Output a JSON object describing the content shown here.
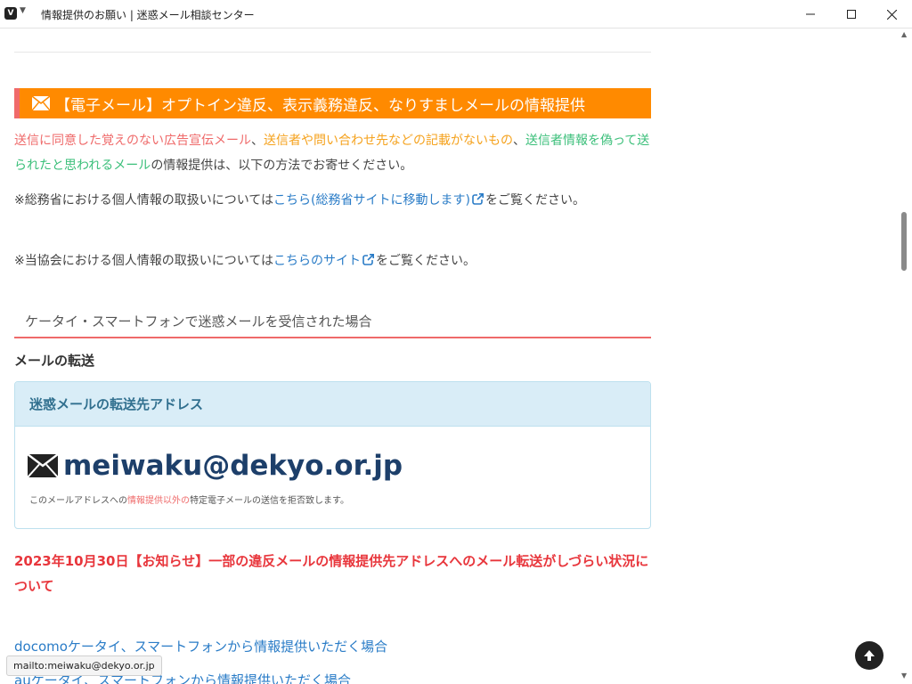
{
  "window": {
    "title": "情報提供のお願い | 迷惑メール相談センター",
    "app_logo": "V"
  },
  "section": {
    "heading": "【電子メール】オプトイン違反、表示義務違反、なりすましメールの情報提供",
    "intro": {
      "part1": "送信に同意した覚えのない広告宣伝メール",
      "sep1": "、",
      "part2": "送信者や問い合わせ先などの記載がないもの",
      "sep2": "、",
      "part3": "送信者情報を偽って送られたと思われるメール",
      "part4": "の情報提供は、以下の方法でお寄せください。"
    },
    "privacy_ministry": {
      "prefix": "※総務省における個人情報の取扱いについては",
      "link": "こちら(総務省サイトに移動します)",
      "suffix": "をご覧ください。"
    },
    "privacy_assoc": {
      "prefix": "※当協会における個人情報の取扱いについては",
      "link": "こちらのサイト",
      "suffix": "をご覧ください。"
    }
  },
  "mobile_heading": "ケータイ・スマートフォンで迷惑メールを受信された場合",
  "forward_heading": "メールの転送",
  "panel": {
    "title": "迷惑メールの転送先アドレス",
    "address": "meiwaku@dekyo.or.jp",
    "note_prefix": "このメールアドレスへの",
    "note_highlight": "情報提供以外の",
    "note_suffix": "特定電子メールの送信を拒否致します。"
  },
  "notice": "2023年10月30日【お知らせ】一部の違反メールの情報提供先アドレスへのメール転送がしづらい状況について",
  "links": [
    "docomoケータイ、スマートフォンから情報提供いただく場合",
    "auケータイ、スマートフォンから情報提供いただく場合"
  ],
  "status_url": "mailto:meiwaku@dekyo.or.jp",
  "colors": {
    "heading_bg": "#ff8a00",
    "accent_red": "#ef6a6a",
    "accent_orange": "#f5a21d",
    "accent_green": "#3bbf7a",
    "link": "#2a7cc7",
    "panel_head_bg": "#d9edf7",
    "notice_red": "#e8363c"
  },
  "icons": [
    "mail-icon",
    "external-link-icon",
    "back-to-top-icon",
    "minimize-icon",
    "maximize-icon",
    "close-icon"
  ]
}
